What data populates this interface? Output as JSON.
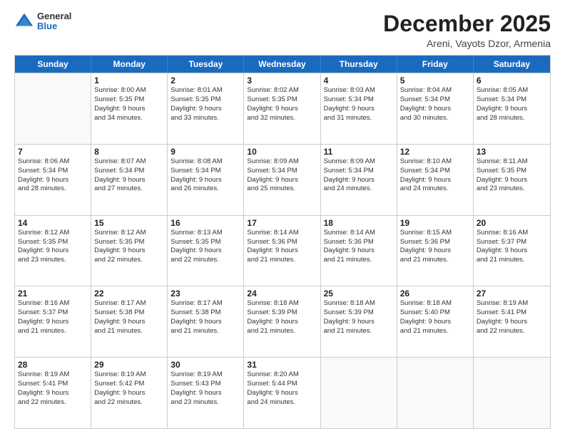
{
  "header": {
    "logo_general": "General",
    "logo_blue": "Blue",
    "month_title": "December 2025",
    "location": "Areni, Vayots Dzor, Armenia"
  },
  "weekdays": [
    "Sunday",
    "Monday",
    "Tuesday",
    "Wednesday",
    "Thursday",
    "Friday",
    "Saturday"
  ],
  "weeks": [
    [
      {
        "day": "",
        "empty": true
      },
      {
        "day": "1",
        "sunrise": "8:00 AM",
        "sunset": "5:35 PM",
        "daylight": "9 hours and 34 minutes."
      },
      {
        "day": "2",
        "sunrise": "8:01 AM",
        "sunset": "5:35 PM",
        "daylight": "9 hours and 33 minutes."
      },
      {
        "day": "3",
        "sunrise": "8:02 AM",
        "sunset": "5:35 PM",
        "daylight": "9 hours and 32 minutes."
      },
      {
        "day": "4",
        "sunrise": "8:03 AM",
        "sunset": "5:34 PM",
        "daylight": "9 hours and 31 minutes."
      },
      {
        "day": "5",
        "sunrise": "8:04 AM",
        "sunset": "5:34 PM",
        "daylight": "9 hours and 30 minutes."
      },
      {
        "day": "6",
        "sunrise": "8:05 AM",
        "sunset": "5:34 PM",
        "daylight": "9 hours and 28 minutes."
      }
    ],
    [
      {
        "day": "7",
        "sunrise": "8:06 AM",
        "sunset": "5:34 PM",
        "daylight": "9 hours and 28 minutes."
      },
      {
        "day": "8",
        "sunrise": "8:07 AM",
        "sunset": "5:34 PM",
        "daylight": "9 hours and 27 minutes."
      },
      {
        "day": "9",
        "sunrise": "8:08 AM",
        "sunset": "5:34 PM",
        "daylight": "9 hours and 26 minutes."
      },
      {
        "day": "10",
        "sunrise": "8:09 AM",
        "sunset": "5:34 PM",
        "daylight": "9 hours and 25 minutes."
      },
      {
        "day": "11",
        "sunrise": "8:09 AM",
        "sunset": "5:34 PM",
        "daylight": "9 hours and 24 minutes."
      },
      {
        "day": "12",
        "sunrise": "8:10 AM",
        "sunset": "5:34 PM",
        "daylight": "9 hours and 24 minutes."
      },
      {
        "day": "13",
        "sunrise": "8:11 AM",
        "sunset": "5:35 PM",
        "daylight": "9 hours and 23 minutes."
      }
    ],
    [
      {
        "day": "14",
        "sunrise": "8:12 AM",
        "sunset": "5:35 PM",
        "daylight": "9 hours and 23 minutes."
      },
      {
        "day": "15",
        "sunrise": "8:12 AM",
        "sunset": "5:35 PM",
        "daylight": "9 hours and 22 minutes."
      },
      {
        "day": "16",
        "sunrise": "8:13 AM",
        "sunset": "5:35 PM",
        "daylight": "9 hours and 22 minutes."
      },
      {
        "day": "17",
        "sunrise": "8:14 AM",
        "sunset": "5:36 PM",
        "daylight": "9 hours and 21 minutes."
      },
      {
        "day": "18",
        "sunrise": "8:14 AM",
        "sunset": "5:36 PM",
        "daylight": "9 hours and 21 minutes."
      },
      {
        "day": "19",
        "sunrise": "8:15 AM",
        "sunset": "5:36 PM",
        "daylight": "9 hours and 21 minutes."
      },
      {
        "day": "20",
        "sunrise": "8:16 AM",
        "sunset": "5:37 PM",
        "daylight": "9 hours and 21 minutes."
      }
    ],
    [
      {
        "day": "21",
        "sunrise": "8:16 AM",
        "sunset": "5:37 PM",
        "daylight": "9 hours and 21 minutes."
      },
      {
        "day": "22",
        "sunrise": "8:17 AM",
        "sunset": "5:38 PM",
        "daylight": "9 hours and 21 minutes."
      },
      {
        "day": "23",
        "sunrise": "8:17 AM",
        "sunset": "5:38 PM",
        "daylight": "9 hours and 21 minutes."
      },
      {
        "day": "24",
        "sunrise": "8:18 AM",
        "sunset": "5:39 PM",
        "daylight": "9 hours and 21 minutes."
      },
      {
        "day": "25",
        "sunrise": "8:18 AM",
        "sunset": "5:39 PM",
        "daylight": "9 hours and 21 minutes."
      },
      {
        "day": "26",
        "sunrise": "8:18 AM",
        "sunset": "5:40 PM",
        "daylight": "9 hours and 21 minutes."
      },
      {
        "day": "27",
        "sunrise": "8:19 AM",
        "sunset": "5:41 PM",
        "daylight": "9 hours and 22 minutes."
      }
    ],
    [
      {
        "day": "28",
        "sunrise": "8:19 AM",
        "sunset": "5:41 PM",
        "daylight": "9 hours and 22 minutes."
      },
      {
        "day": "29",
        "sunrise": "8:19 AM",
        "sunset": "5:42 PM",
        "daylight": "9 hours and 22 minutes."
      },
      {
        "day": "30",
        "sunrise": "8:19 AM",
        "sunset": "5:43 PM",
        "daylight": "9 hours and 23 minutes."
      },
      {
        "day": "31",
        "sunrise": "8:20 AM",
        "sunset": "5:44 PM",
        "daylight": "9 hours and 24 minutes."
      },
      {
        "day": "",
        "empty": true
      },
      {
        "day": "",
        "empty": true
      },
      {
        "day": "",
        "empty": true
      }
    ]
  ],
  "labels": {
    "sunrise_prefix": "Sunrise: ",
    "sunset_prefix": "Sunset: ",
    "daylight_prefix": "Daylight: "
  }
}
